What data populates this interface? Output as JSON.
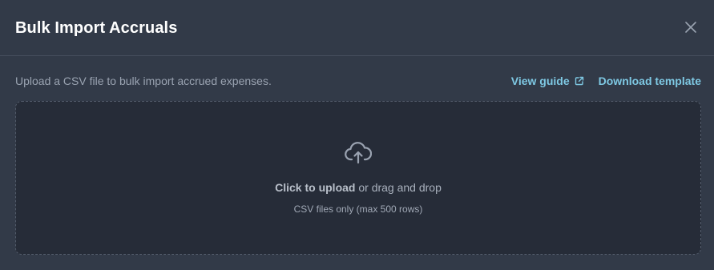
{
  "modal": {
    "title": "Bulk Import Accruals",
    "close_icon": "close-icon"
  },
  "body": {
    "description": "Upload a CSV file to bulk import accrued expenses.",
    "links": {
      "view_guide": "View guide",
      "external_icon": "external-link-icon",
      "download_template": "Download template"
    }
  },
  "dropzone": {
    "icon": "cloud-upload-icon",
    "click_label": "Click to upload",
    "drag_label": " or drag and drop",
    "hint": "CSV files only (max 500 rows)"
  },
  "colors": {
    "background": "#323a48",
    "dropzone_background": "#262c38",
    "accent_link": "#7ec8e3",
    "title": "#ffffff",
    "muted_text": "#9aa3b1"
  }
}
